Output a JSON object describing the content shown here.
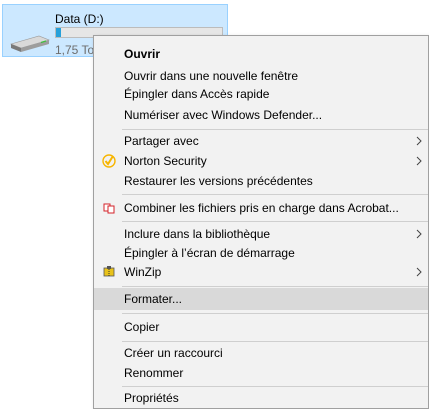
{
  "drive": {
    "label": "Data (D:)",
    "size_text": "1,75 To l",
    "usage_fraction": 0.03,
    "bar_color": "#26a0da",
    "icon": "hard-drive-icon"
  },
  "menu": {
    "open": "Ouvrir",
    "open_new_window": "Ouvrir dans une nouvelle fenêtre",
    "pin_quick_access": "Épingler dans Accès rapide",
    "scan_defender": "Numériser avec Windows Defender...",
    "share_with": "Partager avec",
    "norton": "Norton Security",
    "restore_versions": "Restaurer les versions précédentes",
    "acrobat_combine": "Combiner les fichiers pris en charge dans Acrobat...",
    "include_library": "Inclure dans la bibliothèque",
    "pin_start": "Épingler à l’écran de démarrage",
    "winzip": "WinZip",
    "format": "Formater...",
    "copy": "Copier",
    "create_shortcut": "Créer un raccourci",
    "rename": "Renommer",
    "properties": "Propriétés"
  },
  "colors": {
    "highlight": "#d9d9d9",
    "menu_bg": "#f2f2f2",
    "norton_check": "#f7b500",
    "acrobat_red": "#d4232a",
    "winzip_yellow": "#e8c21a"
  }
}
